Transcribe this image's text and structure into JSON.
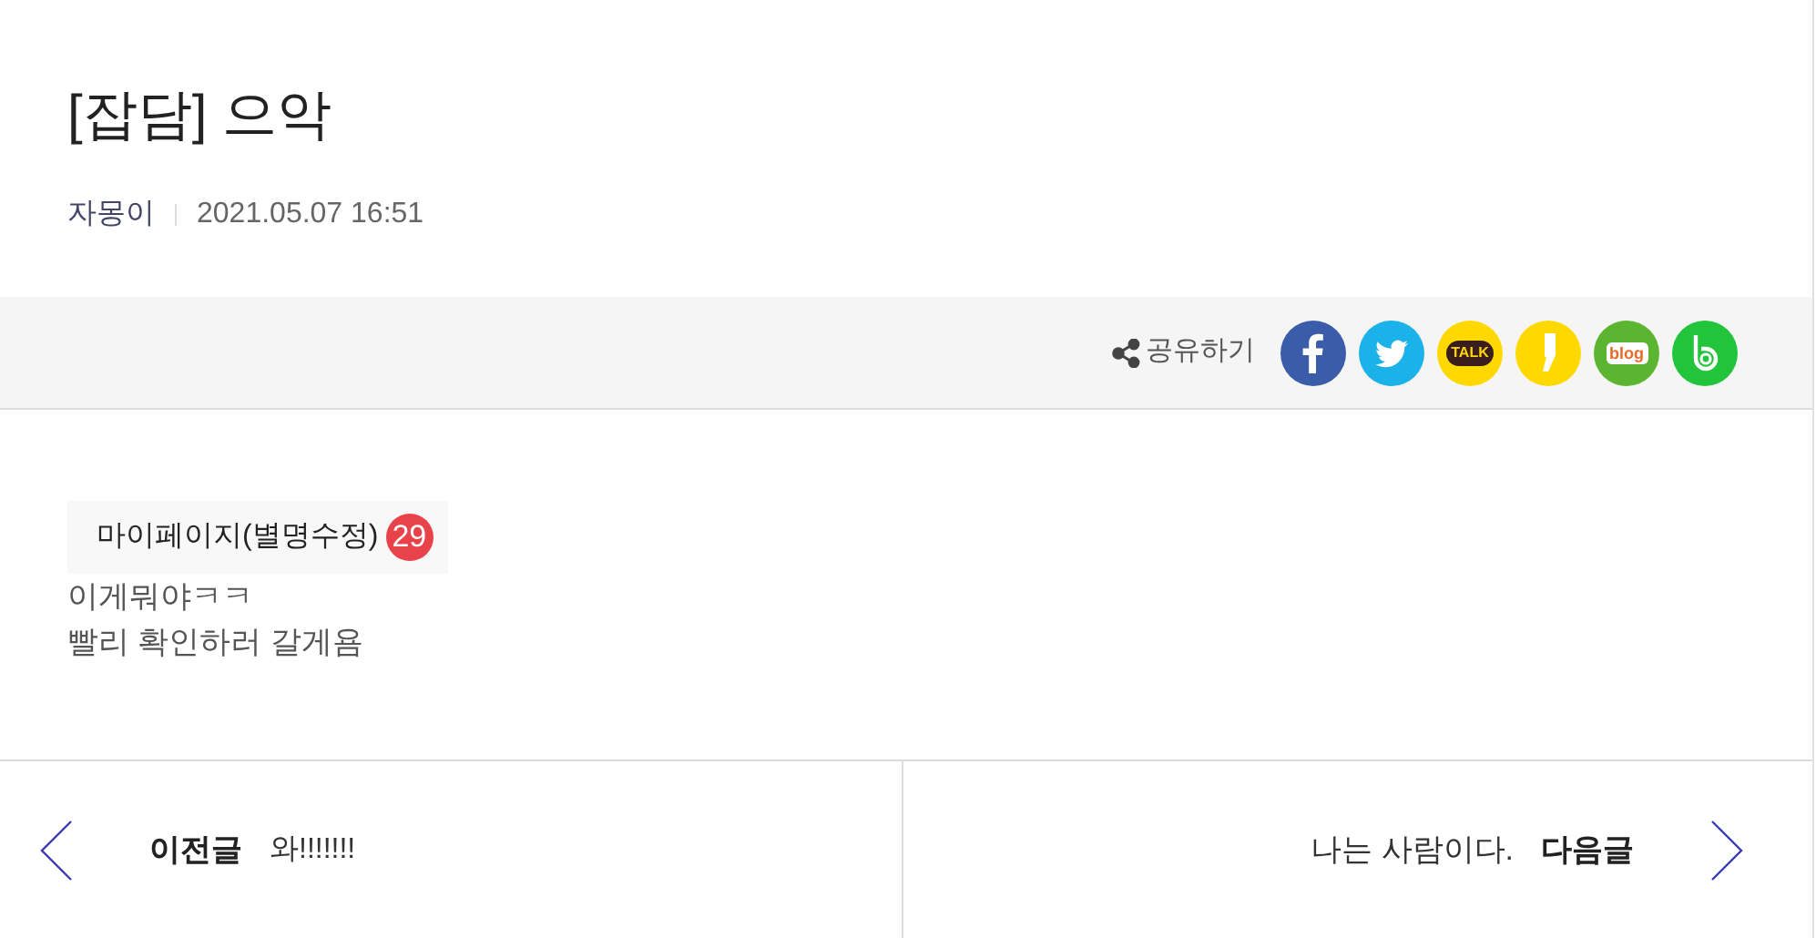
{
  "post": {
    "title": "[잡담] 으악",
    "author": "자몽이",
    "date": "2021.05.07 16:51"
  },
  "share": {
    "label": "공유하기",
    "buttons": [
      {
        "kind": "facebook",
        "color": "#3b5ca8"
      },
      {
        "kind": "twitter",
        "color": "#1ab2e8"
      },
      {
        "kind": "talk",
        "color": "#ffd800",
        "label": "TALK"
      },
      {
        "kind": "story",
        "color": "#ffd800"
      },
      {
        "kind": "blog",
        "color": "#5cb531",
        "label": "blog"
      },
      {
        "kind": "band",
        "color": "#21c43b"
      }
    ]
  },
  "content": {
    "tag": "마이페이지(별명수정)",
    "badge": "29",
    "lines": [
      "이게뭐야ㅋㅋ",
      "빨리 확인하러 갈게욤"
    ]
  },
  "nav": {
    "prev": {
      "label": "이전글",
      "title": "와!!!!!!!"
    },
    "next": {
      "label": "다음글",
      "title": "나는 사람이다."
    }
  }
}
